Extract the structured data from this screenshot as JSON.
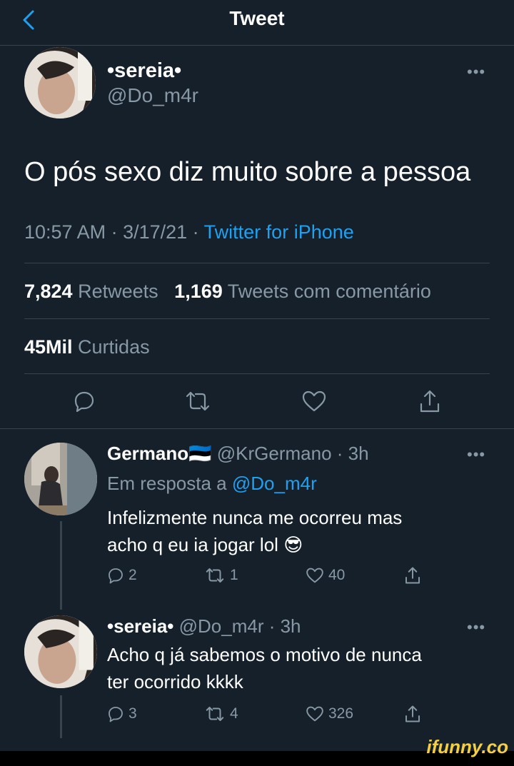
{
  "header": {
    "title": "Tweet"
  },
  "main_tweet": {
    "name": "•sereia•",
    "handle": "@Do_m4r",
    "text": "O pós sexo diz muito sobre a pessoa",
    "time": "10:57 AM · 3/17/21 · ",
    "source": "Twitter for iPhone",
    "retweets_count": "7,824",
    "retweets_label": "Retweets",
    "quotes_count": "1,169",
    "quotes_label": "Tweets com comentário",
    "likes_count": "45Mil",
    "likes_label": "Curtidas"
  },
  "replies": [
    {
      "name": "Germano",
      "flag": "🇪🇪",
      "handle_time": "@KrGermano · 3h",
      "reply_to_label": "Em resposta a ",
      "reply_to": "@Do_m4r",
      "text_line1": "Infelizmente nunca me ocorreu mas",
      "text_line2": "acho q eu ia jogar lol",
      "emoji": "😎",
      "replies": "2",
      "retweets": "1",
      "likes": "40"
    },
    {
      "name": "•sereia•",
      "handle_time": "@Do_m4r · 3h",
      "text_line1": "Acho q já sabemos o motivo de nunca",
      "text_line2": "ter ocorrido kkkk",
      "replies": "3",
      "retweets": "4",
      "likes": "326"
    }
  ],
  "watermark": "ifunny.co",
  "colors": {
    "background": "#15202b",
    "accent": "#1da1f2",
    "muted": "#8899a6",
    "divider": "#38444d"
  },
  "icons": [
    "chevron-left-icon",
    "more-icon",
    "reply-icon",
    "retweet-icon",
    "like-icon",
    "share-icon"
  ]
}
